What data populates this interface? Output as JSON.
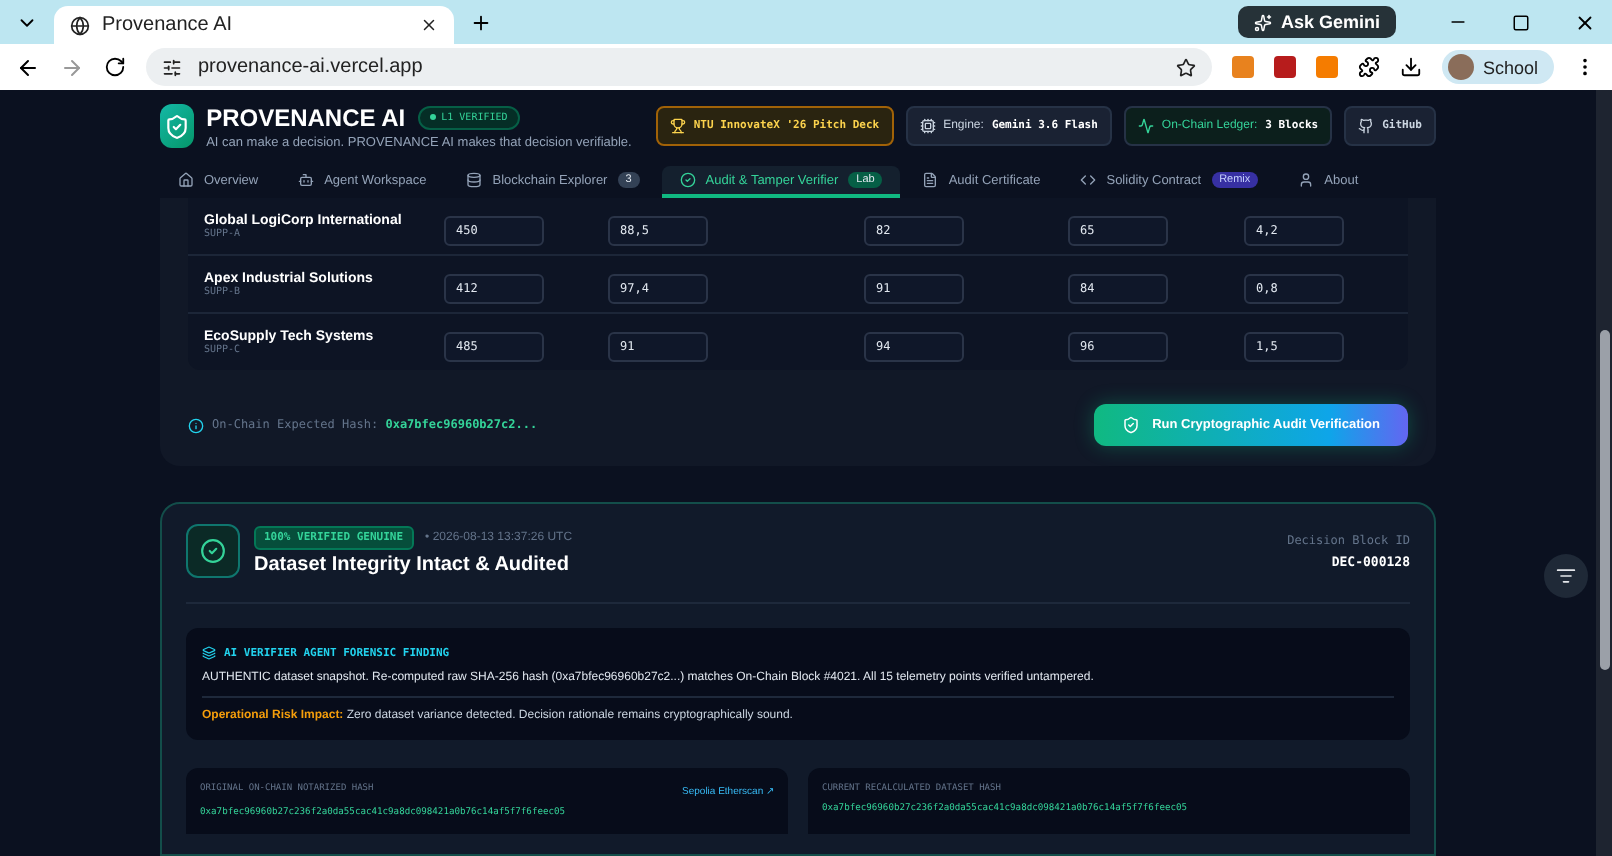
{
  "browser": {
    "tab_title": "Provenance AI",
    "url": "provenance-ai.vercel.app",
    "ask_button": "Ask Gemini",
    "profile": "School"
  },
  "header": {
    "title": "PROVENANCE AI",
    "badge": "L1 VERIFIED",
    "tagline": "AI can make a decision. PROVENANCE AI makes that decision verifiable.",
    "chips": [
      {
        "kind": "award",
        "label": "NTU InnovateX '26 Pitch Deck"
      },
      {
        "kind": "engine",
        "label": "Engine:",
        "value": "Gemini 3.6 Flash"
      },
      {
        "kind": "ledger",
        "label": "On-Chain Ledger:",
        "value": "3 Blocks"
      },
      {
        "kind": "github",
        "label": "GitHub"
      }
    ]
  },
  "tabs": [
    {
      "label": "Overview",
      "selected": false
    },
    {
      "label": "Agent Workspace",
      "selected": false
    },
    {
      "label": "Blockchain Explorer",
      "badge": "3",
      "selected": false
    },
    {
      "label": "Audit & Tamper Verifier",
      "badge": "Lab",
      "selected": true
    },
    {
      "label": "Audit Certificate",
      "selected": false
    },
    {
      "label": "Solidity Contract",
      "badge": "Remix",
      "selected": false
    },
    {
      "label": "About",
      "selected": false
    }
  ],
  "suppliers": [
    {
      "name": "Global LogiCorp International",
      "id": "SUPP-A",
      "values": [
        "450",
        "88,5",
        "82",
        "65",
        "4,2"
      ]
    },
    {
      "name": "Apex Industrial Solutions",
      "id": "SUPP-B",
      "values": [
        "412",
        "97,4",
        "91",
        "84",
        "0,8"
      ]
    },
    {
      "name": "EcoSupply Tech Systems",
      "id": "SUPP-C",
      "values": [
        "485",
        "91",
        "94",
        "96",
        "1,5"
      ]
    }
  ],
  "expected_hash": {
    "label": "On-Chain Expected Hash:",
    "value": "0xa7bfec96960b27c2..."
  },
  "run_button": "Run Cryptographic Audit Verification",
  "result": {
    "badge": "100% VERIFIED GENUINE",
    "timestamp": "• 2026-08-13 13:37:26 UTC",
    "title": "Dataset Integrity Intact & Audited",
    "block_label": "Decision Block ID",
    "block_id": "DEC-000128",
    "finding_title": "AI VERIFIER AGENT FORENSIC FINDING",
    "finding_text": "AUTHENTIC dataset snapshot. Re-computed raw SHA-256 hash (0xa7bfec96960b27c2...) matches On-Chain Block #4021. All 15 telemetry points verified untampered.",
    "risk_label": "Operational Risk Impact:",
    "risk_text": "Zero dataset variance detected. Decision rationale remains cryptographically sound.",
    "hashes": [
      {
        "label": "ORIGINAL ON-CHAIN NOTARIZED HASH",
        "link": "Sepolia Etherscan ↗",
        "value": "0xa7bfec96960b27c236f2a0da55cac41c9a8dc098421a0b76c14af5f7f6feec05"
      },
      {
        "label": "CURRENT RECALCULATED DATASET HASH",
        "value": "0xa7bfec96960b27c236f2a0da55cac41c9a8dc098421a0b76c14af5f7f6feec05"
      }
    ]
  }
}
